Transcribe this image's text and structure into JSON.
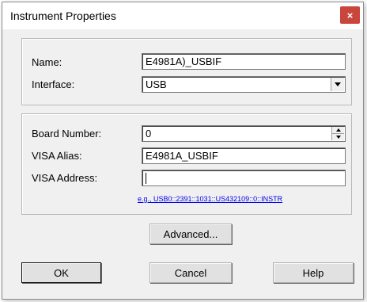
{
  "window": {
    "title": "Instrument Properties",
    "close_label": "×"
  },
  "group1": {
    "name_label": "Name:",
    "name_value": "E4981A)_USBIF",
    "interface_label": "Interface:",
    "interface_value": "USB"
  },
  "group2": {
    "board_label": "Board Number:",
    "board_value": "0",
    "alias_label": "VISA Alias:",
    "alias_value": "E4981A_USBIF",
    "address_label": "VISA Address:",
    "address_value": "",
    "example_link": "e.g., USB0::2391::1031::US432109::0::INSTR"
  },
  "buttons": {
    "advanced": "Advanced...",
    "ok": "OK",
    "cancel": "Cancel",
    "help": "Help"
  },
  "colors": {
    "close_button": "#c9463d",
    "link": "#0000ee",
    "dialog_bg": "#f0f0f0"
  },
  "icons": {
    "close": "close-icon",
    "dropdown": "chevron-down-icon",
    "spinner": "spinner-icon"
  }
}
